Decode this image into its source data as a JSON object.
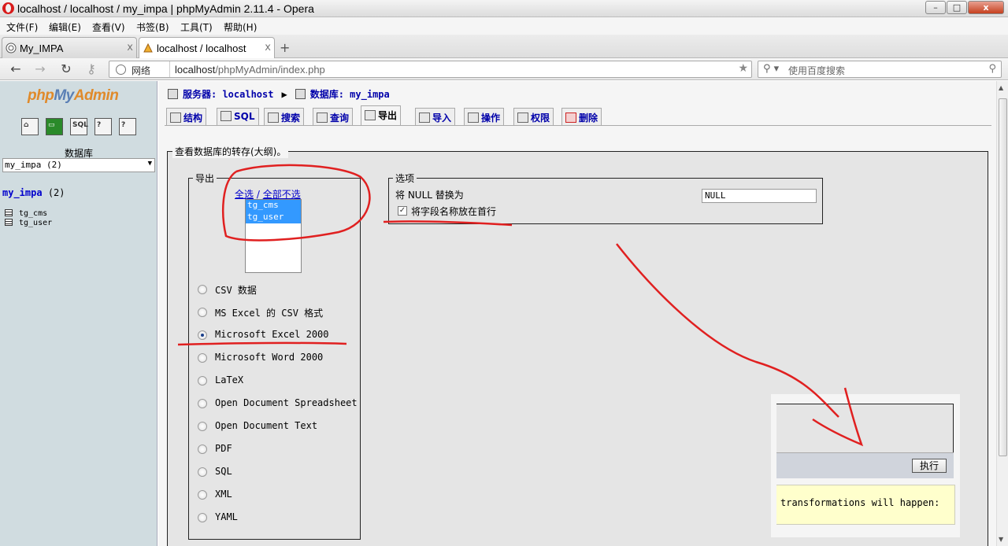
{
  "window": {
    "title": "localhost / localhost / my_impa | phpMyAdmin 2.11.4 - Opera",
    "buttons": {
      "minimize": "–",
      "maximize": "□",
      "close": "x"
    }
  },
  "menu": [
    "文件(F)",
    "编辑(E)",
    "查看(V)",
    "书签(B)",
    "工具(T)",
    "帮助(H)"
  ],
  "tabs": [
    {
      "label": "My_IMPA",
      "close": "x"
    },
    {
      "label": "localhost / localhost",
      "close": "x"
    }
  ],
  "new_tab": "+",
  "address": {
    "site_label": "网络",
    "url_host": "localhost",
    "url_path": "/phpMyAdmin/index.php",
    "search_placeholder": "使用百度搜索"
  },
  "left": {
    "logo_php": "php",
    "logo_my": "My",
    "logo_admin": "Admin",
    "db_label": "数据库",
    "db_select": "my_impa (2)",
    "db_link_name": "my_impa",
    "db_link_count": "(2)",
    "tables": [
      "tg_cms",
      "tg_user"
    ]
  },
  "breadcrumb": {
    "server_label": "服务器: localhost",
    "db_label": "数据库: my_impa"
  },
  "page_tabs": [
    "结构",
    "SQL",
    "搜索",
    "查询",
    "导出",
    "导入",
    "操作",
    "权限",
    "删除"
  ],
  "export": {
    "fieldset_title": "查看数据库的转存(大纲)。",
    "export_legend": "导出",
    "select_all": "全选",
    "separator": "/",
    "select_none": "全部不选",
    "tables": [
      "tg_cms",
      "tg_user"
    ],
    "formats": [
      {
        "label": "CSV 数据",
        "checked": false
      },
      {
        "label": "MS Excel 的 CSV 格式",
        "checked": false
      },
      {
        "label": "Microsoft Excel 2000",
        "checked": true
      },
      {
        "label": "Microsoft Word 2000",
        "checked": false
      },
      {
        "label": "LaTeX",
        "checked": false
      },
      {
        "label": "Open Document Spreadsheet",
        "checked": false
      },
      {
        "label": "Open Document Text",
        "checked": false
      },
      {
        "label": "PDF",
        "checked": false
      },
      {
        "label": "SQL",
        "checked": false
      },
      {
        "label": "XML",
        "checked": false
      },
      {
        "label": "YAML",
        "checked": false
      }
    ],
    "options_legend": "选项",
    "null_label": "将 NULL 替换为",
    "null_value": "NULL",
    "header_checkbox_label": "将字段名称放在首行",
    "header_checked": true,
    "go_label": "执行",
    "notice_text": "transformations will happen:"
  },
  "colors": {
    "annotation": "#e02020",
    "link": "#0000cc",
    "selection": "#3399ff"
  }
}
